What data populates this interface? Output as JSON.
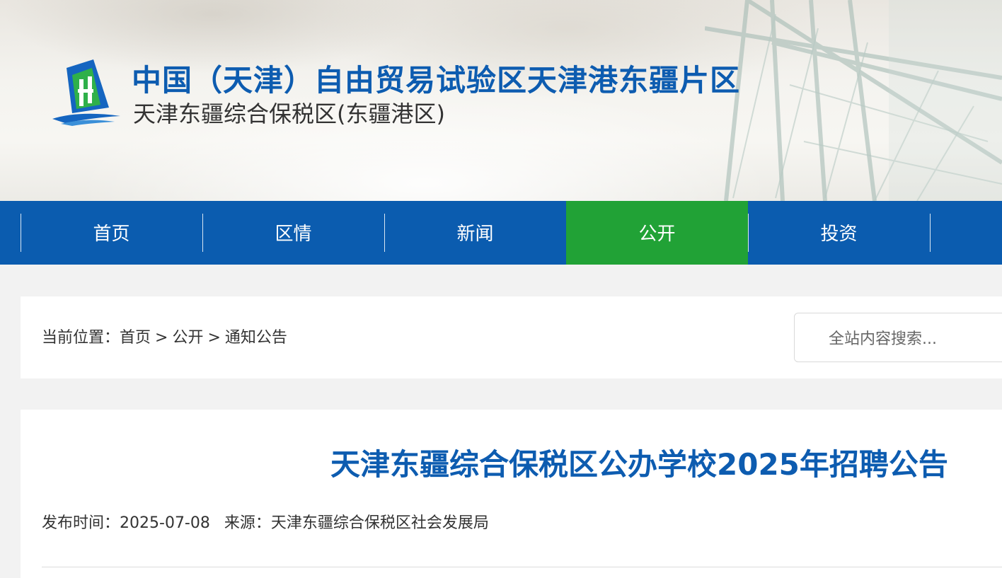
{
  "header": {
    "title_main": "中国（天津）自由贸易试验区天津港东疆片区",
    "title_sub": "天津东疆综合保税区(东疆港区)",
    "brand_color": "#0d5cb0"
  },
  "nav": {
    "items": [
      {
        "label": "首页"
      },
      {
        "label": "区情"
      },
      {
        "label": "新闻"
      },
      {
        "label": "公开"
      },
      {
        "label": "投资"
      }
    ],
    "active_index": 3,
    "bg_color": "#0b5caf",
    "active_color": "#21a236"
  },
  "breadcrumb": {
    "prefix": "当前位置：",
    "items": [
      "首页",
      "公开",
      "通知公告"
    ],
    "separator": ">"
  },
  "search": {
    "placeholder": "全站内容搜索..."
  },
  "article": {
    "title": "天津东疆综合保税区公办学校2025年招聘公告",
    "date_label": "发布时间：",
    "date": "2025-07-08",
    "source_label": "来源：",
    "source": "天津东疆综合保税区社会发展局"
  }
}
